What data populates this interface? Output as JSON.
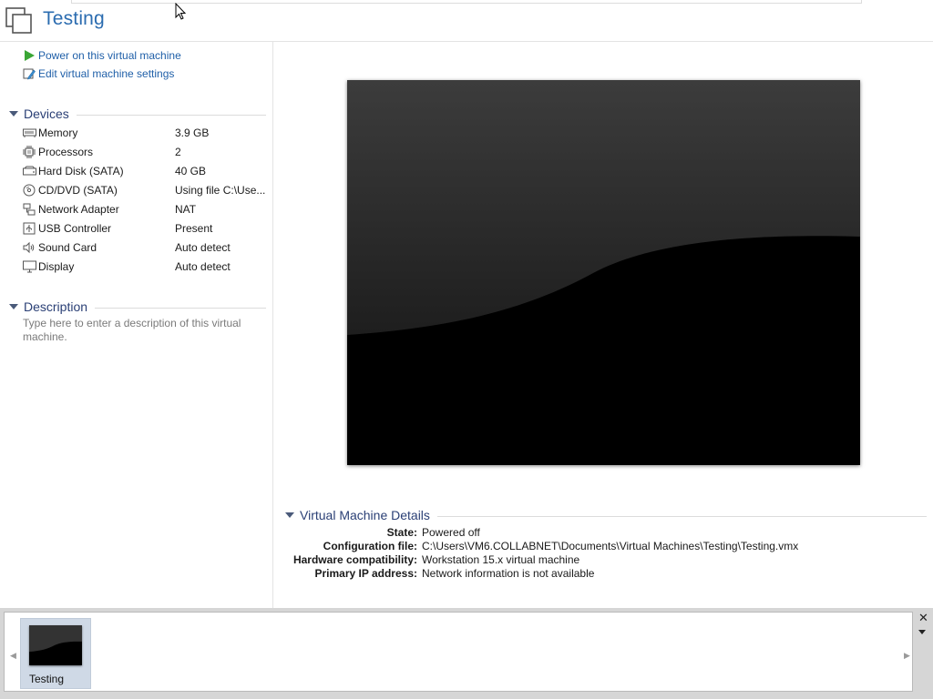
{
  "window": {
    "title": "Testing"
  },
  "actions": [
    {
      "label": "Power on this virtual machine",
      "icon": "play-icon"
    },
    {
      "label": "Edit virtual machine settings",
      "icon": "edit-settings-icon"
    }
  ],
  "devices": {
    "header": "Devices",
    "items": [
      {
        "name": "Memory",
        "value": "3.9 GB",
        "icon": "memory-icon"
      },
      {
        "name": "Processors",
        "value": "2",
        "icon": "processor-icon"
      },
      {
        "name": "Hard Disk (SATA)",
        "value": "40 GB",
        "icon": "hard-disk-icon"
      },
      {
        "name": "CD/DVD (SATA)",
        "value": "Using file C:\\Use...",
        "icon": "cd-dvd-icon"
      },
      {
        "name": "Network Adapter",
        "value": "NAT",
        "icon": "network-adapter-icon"
      },
      {
        "name": "USB Controller",
        "value": "Present",
        "icon": "usb-icon"
      },
      {
        "name": "Sound Card",
        "value": "Auto detect",
        "icon": "sound-icon"
      },
      {
        "name": "Display",
        "value": "Auto detect",
        "icon": "display-icon"
      }
    ]
  },
  "description": {
    "header": "Description",
    "placeholder": "Type here to enter a description of this virtual machine."
  },
  "details": {
    "header": "Virtual Machine Details",
    "rows": [
      {
        "key": "State:",
        "value": "Powered off"
      },
      {
        "key": "Configuration file:",
        "value": "C:\\Users\\VM6.COLLABNET\\Documents\\Virtual Machines\\Testing\\Testing.vmx"
      },
      {
        "key": "Hardware compatibility:",
        "value": "Workstation 15.x virtual machine"
      },
      {
        "key": "Primary IP address:",
        "value": "Network information is not available"
      }
    ]
  },
  "thumbnail_bar": {
    "items": [
      {
        "label": "Testing"
      }
    ],
    "close_symbol": "✕",
    "scroll_left": "◀",
    "scroll_right": "▶"
  },
  "colors": {
    "link": "#1f5fa8",
    "title": "#2b6cb0",
    "section": "#2a3f75",
    "play": "#3aa635"
  }
}
